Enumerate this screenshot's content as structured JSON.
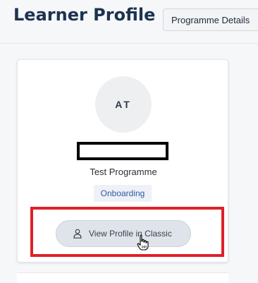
{
  "header": {
    "title": "Learner Profile",
    "programme_details_label": "Programme Details"
  },
  "profile": {
    "initials": "AT",
    "programme": "Test Programme",
    "status": "Onboarding",
    "classic_button_label": "View Profile in Classic"
  },
  "colors": {
    "title": "#1c3350",
    "highlight": "#e0202a",
    "badge_text": "#2e5aa8"
  },
  "icons": {
    "user": "user-icon",
    "cursor": "hand-pointer-icon"
  }
}
